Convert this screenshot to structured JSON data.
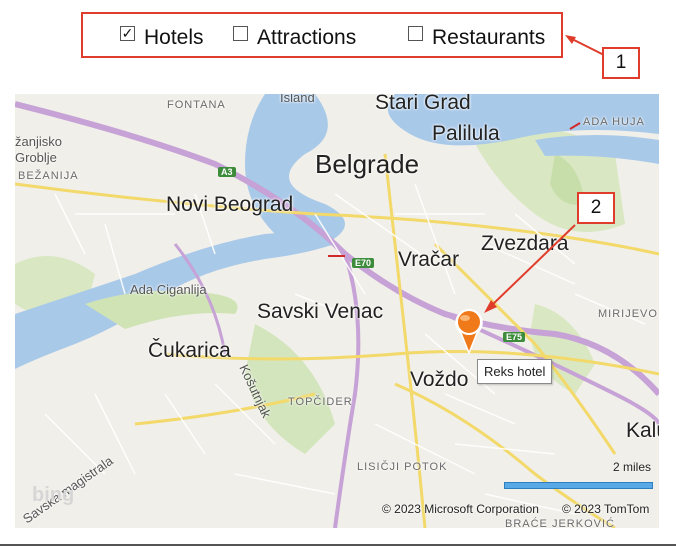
{
  "filters": [
    {
      "label": "Hotels",
      "checked": true
    },
    {
      "label": "Attractions",
      "checked": false
    },
    {
      "label": "Restaurants",
      "checked": false
    }
  ],
  "callouts": {
    "one": "1",
    "two": "2"
  },
  "map": {
    "city_labels": {
      "belgrade": "Belgrade",
      "stari_grad": "Stari Grad",
      "palilula": "Palilula",
      "novi_beograd": "Novi Beograd",
      "zvezdara": "Zvezdara",
      "vracar": "Vračar",
      "savski_venac": "Savski Venac",
      "cukarica": "Čukarica",
      "vozdovac": "Voždo",
      "kalude": "Kaluđ"
    },
    "small_labels": {
      "fontana": "FONTANA",
      "island": "Island",
      "ada_huja": "ADA HUJA",
      "zanjisko": "žanjisko",
      "groblje": "Groblje",
      "bezanija": "BEŽANIJA",
      "ada_ciganlija": "Ada Ciganlija",
      "kosutnjak": "Košutnjak",
      "topcider": "TOPČIDER",
      "mirijevo": "MIRIJEVO",
      "lisicji_potok": "LISIČJI POTOK",
      "brace_jerkovic": "BRAĆE JERKOVIĆ",
      "savska": "Savska magistrala"
    },
    "road_badges": {
      "a3": "A3",
      "e70": "E70",
      "e75": "E75"
    },
    "pin_tooltip": "Reks hotel",
    "scale_label": "2 miles",
    "copyright_ms": "© 2023 Microsoft Corporation",
    "copyright_tomtom": "© 2023 TomTom",
    "logo": "bing",
    "colors": {
      "water": "#a9c9e9",
      "park": "#cfe3b5",
      "road_major": "#f2d96a",
      "highway": "#c6a2d6",
      "pin": "#f07a1a",
      "annotation": "#e03c2c"
    }
  }
}
